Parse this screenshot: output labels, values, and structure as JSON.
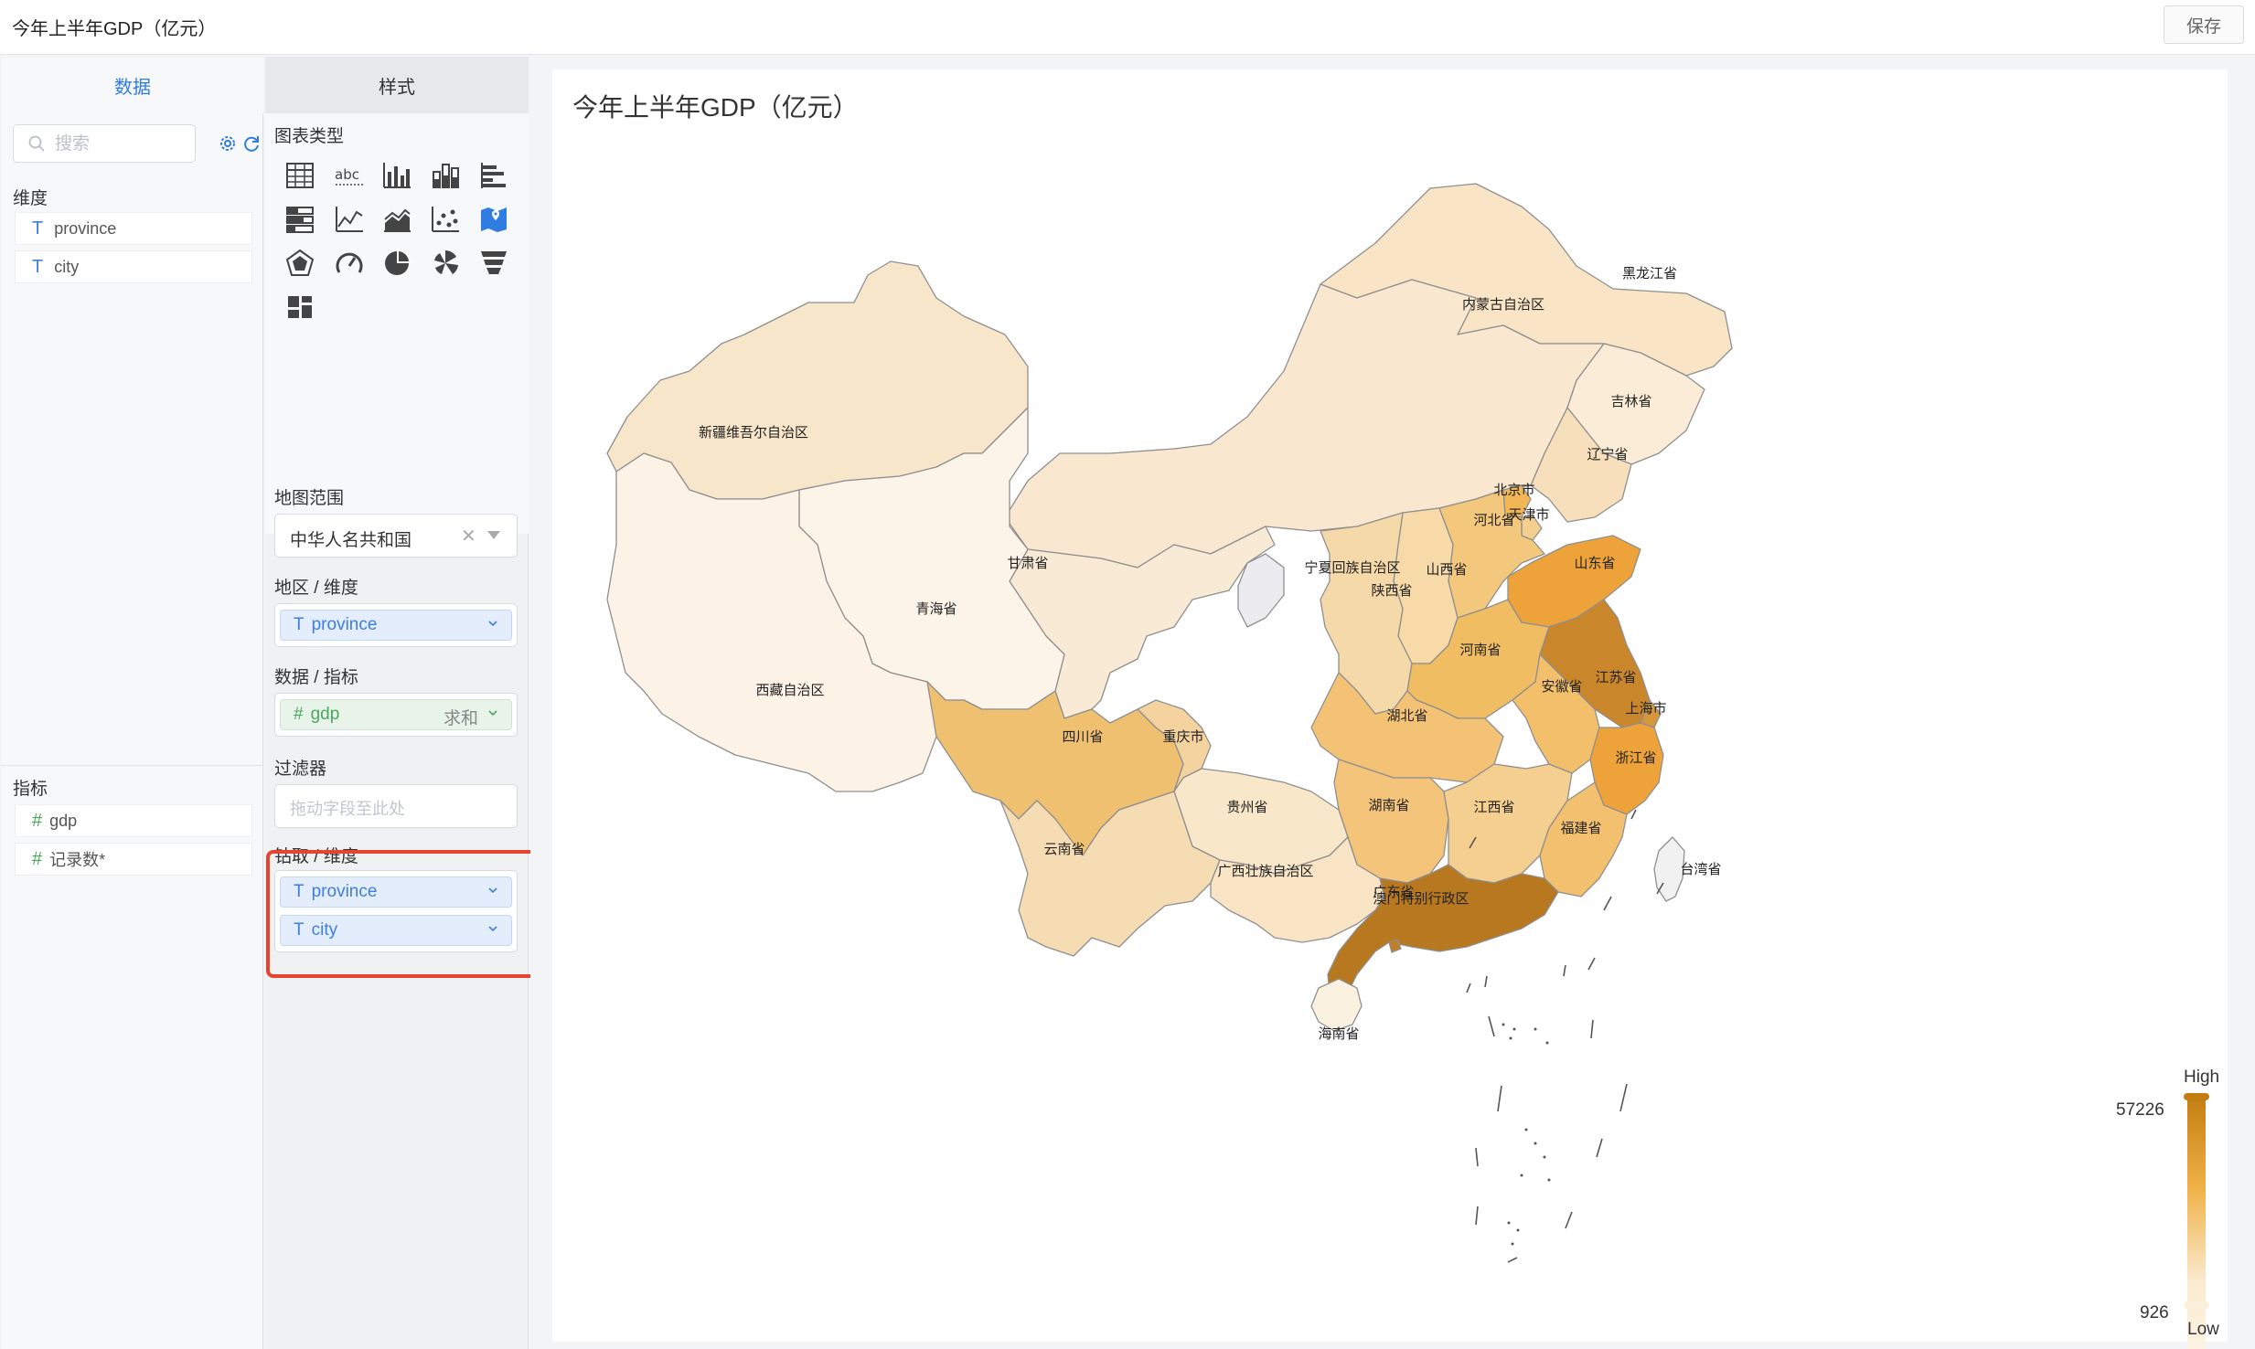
{
  "header": {
    "title": "今年上半年GDP（亿元）",
    "save_label": "保存"
  },
  "data_panel": {
    "tab_label": "数据",
    "search_placeholder": "搜索",
    "dimensions_label": "维度",
    "dimensions": [
      {
        "type": "T",
        "name": "province"
      },
      {
        "type": "T",
        "name": "city"
      }
    ],
    "measures_label": "指标",
    "measures": [
      {
        "type": "#",
        "name": "gdp"
      },
      {
        "type": "#",
        "name": "记录数*"
      }
    ]
  },
  "style_panel": {
    "tab_label": "样式",
    "chart_types_label": "图表类型",
    "chart_types": [
      "table-icon",
      "text-abc-icon",
      "column-chart-icon",
      "stacked-column-icon",
      "bar-chart-icon",
      "stacked-bar-icon",
      "line-chart-icon",
      "area-chart-icon",
      "scatter-icon",
      "map-icon",
      "radar-icon",
      "gauge-icon",
      "pie-icon",
      "rose-icon",
      "funnel-icon",
      "dashboard-icon"
    ],
    "selected_chart_type": "map-icon",
    "map_range_label": "地图范围",
    "map_range_value": "中华人名共和国",
    "region_label": "地区 / 维度",
    "region_value": "province",
    "metric_label": "数据 / 指标",
    "metric_value": "gdp",
    "metric_agg": "求和",
    "filter_label": "过滤器",
    "filter_placeholder": "拖动字段至此处",
    "drill_label": "钻取 / 维度",
    "drill_fields": [
      "province",
      "city"
    ]
  },
  "chart": {
    "title": "今年上半年GDP（亿元）",
    "legend": {
      "high_label": "High",
      "low_label": "Low",
      "max": "57226",
      "min": "926"
    }
  },
  "chart_data": {
    "type": "map",
    "title": "今年上半年GDP（亿元）",
    "color_scale": {
      "min": 926,
      "max": 57226,
      "low_color": "#fdf6ea",
      "high_color": "#c27d10"
    },
    "regions": [
      {
        "name": "黑龙江省"
      },
      {
        "name": "吉林省"
      },
      {
        "name": "辽宁省"
      },
      {
        "name": "内蒙古自治区"
      },
      {
        "name": "新疆维吾尔自治区"
      },
      {
        "name": "北京市"
      },
      {
        "name": "天津市"
      },
      {
        "name": "河北省"
      },
      {
        "name": "山东省"
      },
      {
        "name": "甘肃省"
      },
      {
        "name": "宁夏回族自治区"
      },
      {
        "name": "山西省"
      },
      {
        "name": "陕西省"
      },
      {
        "name": "青海省"
      },
      {
        "name": "河南省"
      },
      {
        "name": "江苏省"
      },
      {
        "name": "安徽省"
      },
      {
        "name": "上海市"
      },
      {
        "name": "西藏自治区"
      },
      {
        "name": "四川省"
      },
      {
        "name": "重庆市"
      },
      {
        "name": "湖北省"
      },
      {
        "name": "浙江省"
      },
      {
        "name": "湖南省"
      },
      {
        "name": "江西省"
      },
      {
        "name": "贵州省"
      },
      {
        "name": "福建省"
      },
      {
        "name": "云南省"
      },
      {
        "name": "广西壮族自治区"
      },
      {
        "name": "广东省"
      },
      {
        "name": "台湾省"
      },
      {
        "name": "海南省"
      },
      {
        "name": "澳门特别行政区"
      }
    ]
  },
  "colors": {
    "accent": "#2f7de1",
    "highlight": "#e8432e",
    "map_stroke": "#9b9b9b"
  }
}
